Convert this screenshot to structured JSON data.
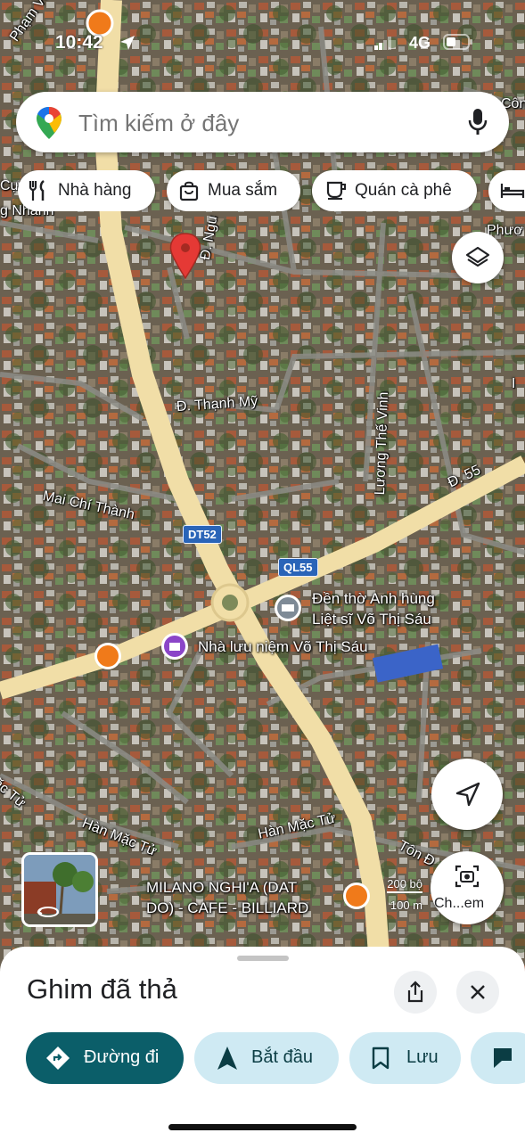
{
  "status_bar": {
    "time": "10:42",
    "network": "4G"
  },
  "search": {
    "placeholder": "Tìm kiếm ở đây"
  },
  "chips": [
    {
      "label": "Nhà hàng",
      "icon": "fork-knife-icon"
    },
    {
      "label": "Mua sắm",
      "icon": "shopping-bag-icon"
    },
    {
      "label": "Quán cà phê",
      "icon": "coffee-cup-icon"
    },
    {
      "label": "",
      "icon": "bed-icon"
    }
  ],
  "map_labels": {
    "street_top_left": "Phạm Văn",
    "street_top_right": "Côn",
    "street_cu": "Cự",
    "street_nhanh": "g Nhanh",
    "street_nguyen": "Đ. Ngu",
    "street_phuoc": "Phươ",
    "street_thanh_my": "Đ. Thạnh Mỹ",
    "street_mai_chi_thanh": "Mai Chí Thành",
    "street_luong_the_vinh": "Lương Thế Vinh",
    "street_d55": "Đ. 55",
    "route_dt52": "DT52",
    "route_ql55": "QL55",
    "poi_temple": "Đền thờ Anh hùng\nLiệt sĩ Võ Thị Sáu",
    "poi_museum": "Nhà lưu niệm Võ Thị Sáu",
    "street_han_mac_tu_1": "Hàn Mặc Tử",
    "street_han_mac_tu_2": "Hàn Mặc Tử",
    "street_ac_tu": "ặc Tử",
    "street_ton": "Tôn Đ",
    "street_right_edge": "I",
    "poi_cafe": "MILANO NGHI'A (DAT\nDO) - CAFE - BILLIARD",
    "scale_ft": "200 bộ",
    "scale_m": "100 m"
  },
  "buttons": {
    "layers_icon": "layers-icon",
    "locate_icon": "navigation-arrow-icon",
    "screenshot_label": "Ch...em"
  },
  "sheet": {
    "title": "Ghim đã thả",
    "share_icon": "share-icon",
    "close_icon": "close-icon",
    "actions": [
      {
        "label": "Đường đi",
        "icon": "directions-icon",
        "primary": true
      },
      {
        "label": "Bắt đầu",
        "icon": "navigation-start-icon",
        "primary": false
      },
      {
        "label": "Lưu",
        "icon": "bookmark-icon",
        "primary": false
      },
      {
        "label": "",
        "icon": "flag-icon",
        "primary": false
      }
    ]
  },
  "colors": {
    "primary_teal": "#0b5e69",
    "chip_tint": "#cfeaf3",
    "pin_red": "#e53935",
    "road_yellow": "#efdba2",
    "route_shield": "#2a64b8"
  }
}
